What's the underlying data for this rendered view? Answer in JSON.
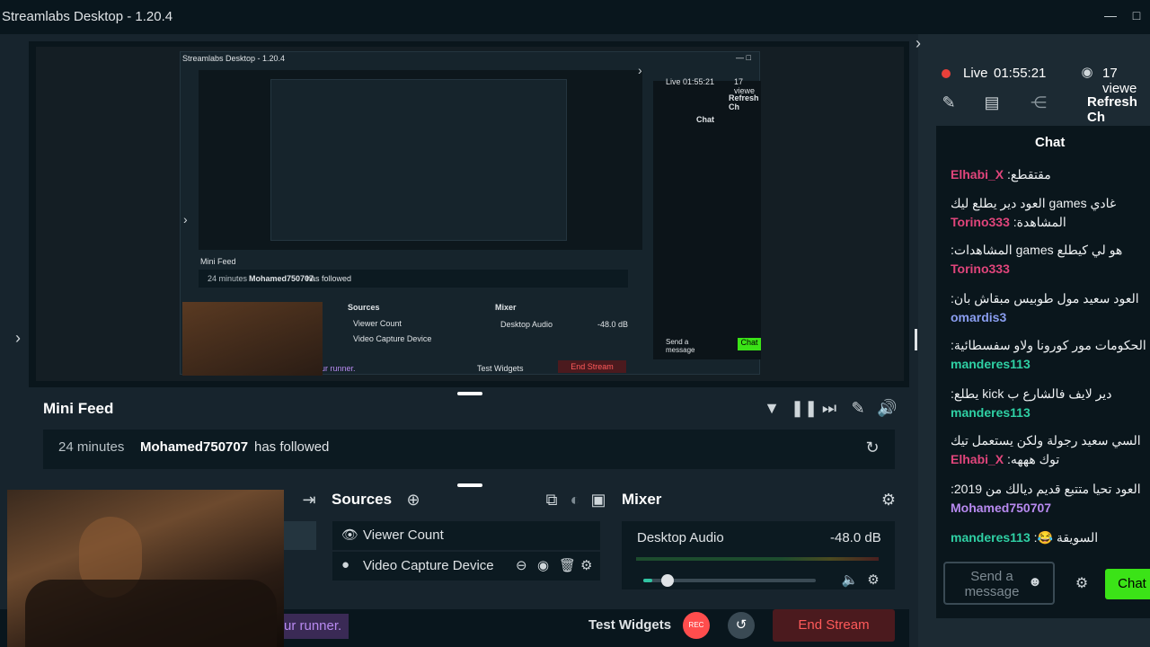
{
  "window": {
    "title": "Streamlabs Desktop - 1.20.4",
    "minimize": "—",
    "maximize": "□"
  },
  "nested": {
    "title": "Streamlabs Desktop - 1.20.4",
    "live": "Live 01:55:21",
    "viewers": "17 viewe",
    "refresh": "Refresh Ch",
    "chat_title": "Chat",
    "mini_feed": "Mini Feed",
    "feed_time": "24 minutes",
    "feed_user": "Mohamed750707",
    "feed_action": "has followed",
    "sources": "Sources",
    "mixer": "Mixer",
    "source1": "Viewer Count",
    "source2": "Video Capture Device",
    "desktop_audio": "Desktop Audio",
    "db": "-48.0 dB",
    "runner": "ur runner.",
    "test_widgets": "Test Widgets",
    "end_stream": "End Stream",
    "send_msg": "Send a message",
    "chat_btn": "Chat"
  },
  "mini_feed": {
    "title": "Mini Feed",
    "time": "24 minutes",
    "user": "Mohamed750707",
    "action": "has followed"
  },
  "sources": {
    "title": "Sources",
    "items": [
      "Viewer Count",
      "Video Capture Device"
    ]
  },
  "mixer": {
    "title": "Mixer",
    "channel": "Desktop Audio",
    "level": "-48.0 dB",
    "volume_fraction": 0.05
  },
  "bottom": {
    "runner": "ur runner.",
    "rec": "REC",
    "test_widgets": "Test Widgets",
    "end_stream": "End Stream"
  },
  "live": {
    "status": "Live",
    "time": "01:55:21",
    "viewers": "17 viewe",
    "refresh": "Refresh Ch",
    "color": "#e8403a"
  },
  "chat": {
    "title": "Chat",
    "messages": [
      {
        "user": "Elhabi_X",
        "color": "#e0457b",
        "text": "مقتقطع"
      },
      {
        "user": "Torino333",
        "color": "#e0457b",
        "text": "غادي games العود دير يطلع ليك المشاهدة"
      },
      {
        "user": "Torino333",
        "color": "#e0457b",
        "text": "هو لي كيطلع games المشاهدات"
      },
      {
        "user": "omardis3",
        "color": "#8a9ef0",
        "text": "العود سعيد مول طوبيس مبقاش بان"
      },
      {
        "user": "manderes113",
        "color": "#2fd0a4",
        "text": "الحكومات مور كورونا ولاو سفسطائية"
      },
      {
        "user": "manderes113",
        "color": "#2fd0a4",
        "text": "دير لايف فالشارع ب kick يطلع"
      },
      {
        "user": "Elhabi_X",
        "color": "#e0457b",
        "text": "السي سعيد رجولة ولكن يستعمل تيك توك هههه"
      },
      {
        "user": "Mohamed750707",
        "color": "#b88af0",
        "text": "العود تحيا متتبع قديم ديالك من 2019"
      },
      {
        "user": "manderes113",
        "color": "#2fd0a4",
        "text": "السويقة 😂"
      }
    ],
    "input_placeholder": "Send a message",
    "send_label": "Chat",
    "accent": "#31c3a2",
    "send_color": "#3be317"
  }
}
